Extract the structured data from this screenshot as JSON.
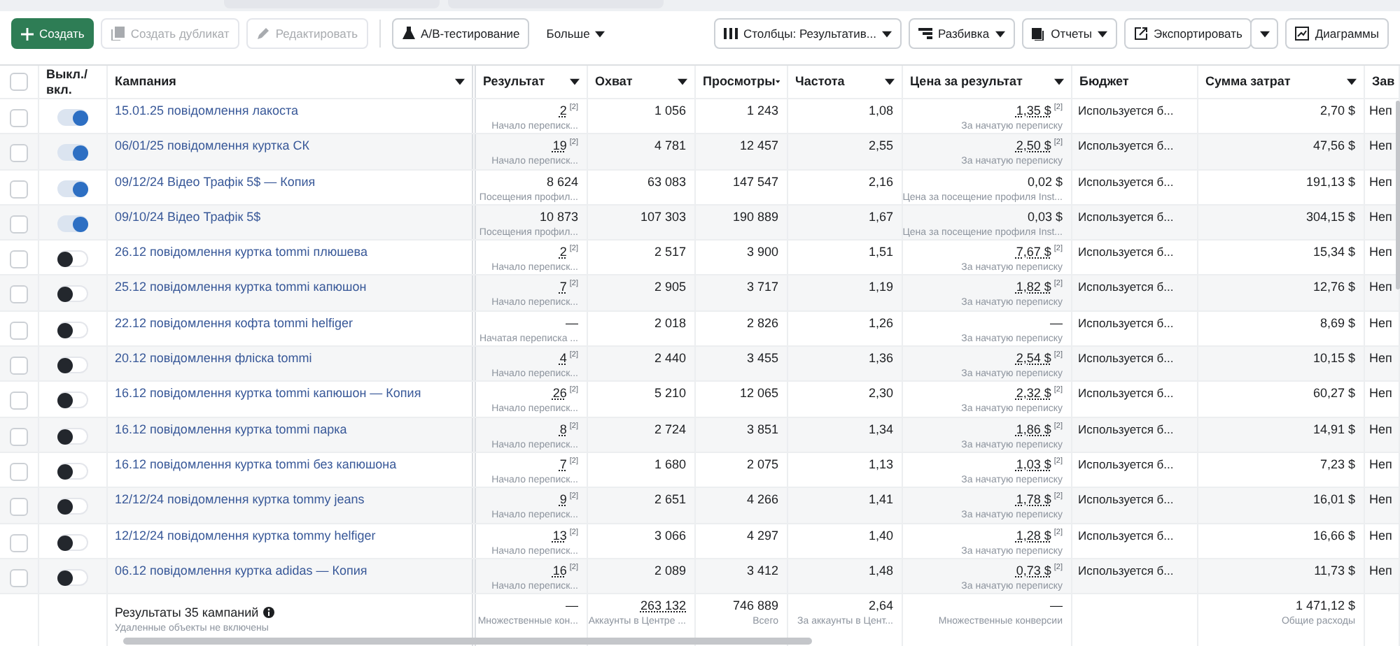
{
  "toolbar": {
    "left": [
      {
        "label": "Создать",
        "kind": "primary",
        "disabled": false
      },
      {
        "label": "Создать дубликат",
        "kind": "default",
        "disabled": true
      },
      {
        "label": "Редактировать",
        "kind": "default",
        "disabled": true
      },
      {
        "label": "A/B-тестирование",
        "kind": "default",
        "disabled": false
      },
      {
        "label": "Больше",
        "kind": "menu",
        "disabled": false
      }
    ],
    "right": [
      {
        "label": "Столбцы: Результатив...",
        "kind": "dropdown",
        "disabled": false
      },
      {
        "label": "Разбивка",
        "kind": "dropdown",
        "disabled": false
      },
      {
        "label": "Отчеты",
        "kind": "dropdown",
        "disabled": false
      },
      {
        "label": "Экспортировать",
        "kind": "split",
        "disabled": false
      },
      {
        "label": "Диаграммы",
        "kind": "default",
        "disabled": false
      }
    ]
  },
  "table": {
    "header_checkbox": {
      "checked": false
    },
    "columns": [
      {
        "label": "Выкл./вкл.",
        "sortable": false
      },
      {
        "label": "Кампания",
        "sortable": true
      },
      {
        "label": "Результат",
        "sortable": true
      },
      {
        "label": "Охват",
        "sortable": true
      },
      {
        "label": "Просмотры",
        "sortable": true
      },
      {
        "label": "Частота",
        "sortable": true
      },
      {
        "label": "Цена за результат",
        "sortable": true
      },
      {
        "label": "Бюджет",
        "sortable": false
      },
      {
        "label": "Сумма затрат",
        "sortable": true
      },
      {
        "label": "Зав"
      }
    ],
    "rows": [
      {
        "checked": false,
        "on": true,
        "campaign": "15.01.25 повідомлення лакоста",
        "result": {
          "value": "2",
          "footnote": "[2]",
          "caption": "Начало переписк..."
        },
        "reach": "1 056",
        "views": "1 243",
        "frequency": "1,08",
        "price": {
          "value": "1,35 $",
          "footnote": "[2]",
          "caption": "За начатую переписку"
        },
        "budget": "Используется б...",
        "spend": "2,70 $",
        "column_10": "Неп"
      },
      {
        "checked": false,
        "on": true,
        "campaign": "06/01/25 повідомлення куртка СК",
        "result": {
          "value": "19",
          "footnote": "[2]",
          "caption": "Начало переписк..."
        },
        "reach": "4 781",
        "views": "12 457",
        "frequency": "2,55",
        "price": {
          "value": "2,50 $",
          "footnote": "[2]",
          "caption": "За начатую переписку"
        },
        "budget": "Используется б...",
        "spend": "47,56 $",
        "column_10": "Неп"
      },
      {
        "checked": false,
        "on": true,
        "campaign": "09/12/24 Відео Трафік 5$ — Копия",
        "result": {
          "value": "8 624",
          "caption": "Посещения профил..."
        },
        "reach": "63 083",
        "views": "147 547",
        "frequency": "2,16",
        "price": {
          "value": "0,02 $",
          "caption": "Цена за посещение профиля Inst..."
        },
        "budget": "Используется б...",
        "spend": "191,13 $",
        "column_10": "Неп"
      },
      {
        "checked": false,
        "on": true,
        "campaign": "09/10/24 Відео Трафік 5$",
        "result": {
          "value": "10 873",
          "caption": "Посещения профил..."
        },
        "reach": "107 303",
        "views": "190 889",
        "frequency": "1,67",
        "price": {
          "value": "0,03 $",
          "caption": "Цена за посещение профиля Inst..."
        },
        "budget": "Используется б...",
        "spend": "304,15 $",
        "column_10": "Неп"
      },
      {
        "checked": false,
        "on": false,
        "campaign": "26.12 повідомлення куртка tommi плюшева",
        "result": {
          "value": "2",
          "footnote": "[2]",
          "caption": "Начало переписк..."
        },
        "reach": "2 517",
        "views": "3 900",
        "frequency": "1,51",
        "price": {
          "value": "7,67 $",
          "footnote": "[2]",
          "caption": "За начатую переписку"
        },
        "budget": "Используется б...",
        "spend": "15,34 $",
        "column_10": "Неп"
      },
      {
        "checked": false,
        "on": false,
        "campaign": "25.12 повідомлення куртка tommi капюшон",
        "result": {
          "value": "7",
          "footnote": "[2]",
          "caption": "Начало переписк..."
        },
        "reach": "2 905",
        "views": "3 717",
        "frequency": "1,19",
        "price": {
          "value": "1,82 $",
          "footnote": "[2]",
          "caption": "За начатую переписку"
        },
        "budget": "Используется б...",
        "spend": "12,76 $",
        "column_10": "Неп"
      },
      {
        "checked": false,
        "on": false,
        "campaign": "22.12 повідомлення кофта tommi helfiger",
        "result": {
          "value": "—",
          "caption": "Начатая переписка ..."
        },
        "reach": "2 018",
        "views": "2 826",
        "frequency": "1,26",
        "price": {
          "value": "—",
          "caption": "За начатую переписку"
        },
        "budget": "Используется б...",
        "spend": "8,69 $",
        "column_10": "Неп"
      },
      {
        "checked": false,
        "on": false,
        "campaign": "20.12 повідомлення фліска tommi",
        "result": {
          "value": "4",
          "footnote": "[2]",
          "caption": "Начало переписк..."
        },
        "reach": "2 440",
        "views": "3 455",
        "frequency": "1,36",
        "price": {
          "value": "2,54 $",
          "footnote": "[2]",
          "caption": "За начатую переписку"
        },
        "budget": "Используется б...",
        "spend": "10,15 $",
        "column_10": "Неп"
      },
      {
        "checked": false,
        "on": false,
        "campaign": "16.12 повідомлення куртка tommi капюшон — Копия",
        "result": {
          "value": "26",
          "footnote": "[2]",
          "caption": "Начало переписк..."
        },
        "reach": "5 210",
        "views": "12 065",
        "frequency": "2,30",
        "price": {
          "value": "2,32 $",
          "footnote": "[2]",
          "caption": "За начатую переписку"
        },
        "budget": "Используется б...",
        "spend": "60,27 $",
        "column_10": "Неп"
      },
      {
        "checked": false,
        "on": false,
        "campaign": "16.12 повідомлення куртка tommi парка",
        "result": {
          "value": "8",
          "footnote": "[2]",
          "caption": "Начало переписк..."
        },
        "reach": "2 724",
        "views": "3 851",
        "frequency": "1,34",
        "price": {
          "value": "1,86 $",
          "footnote": "[2]",
          "caption": "За начатую переписку"
        },
        "budget": "Используется б...",
        "spend": "14,91 $",
        "column_10": "Неп"
      },
      {
        "checked": false,
        "on": false,
        "campaign": "16.12 повідомлення куртка tommi без капюшона",
        "result": {
          "value": "7",
          "footnote": "[2]",
          "caption": "Начало переписк..."
        },
        "reach": "1 680",
        "views": "2 075",
        "frequency": "1,13",
        "price": {
          "value": "1,03 $",
          "footnote": "[2]",
          "caption": "За начатую переписку"
        },
        "budget": "Используется б...",
        "spend": "7,23 $",
        "column_10": "Неп"
      },
      {
        "checked": false,
        "on": false,
        "campaign": "12/12/24 повідомлення куртка tommy jeans",
        "result": {
          "value": "9",
          "footnote": "[2]",
          "caption": "Начало переписк..."
        },
        "reach": "2 651",
        "views": "4 266",
        "frequency": "1,41",
        "price": {
          "value": "1,78 $",
          "footnote": "[2]",
          "caption": "За начатую переписку"
        },
        "budget": "Используется б...",
        "spend": "16,01 $",
        "column_10": "Неп"
      },
      {
        "checked": false,
        "on": false,
        "campaign": "12/12/24 повідомлення куртка tommy helfiger",
        "result": {
          "value": "13",
          "footnote": "[2]",
          "caption": "Начало переписк..."
        },
        "reach": "3 066",
        "views": "4 297",
        "frequency": "1,40",
        "price": {
          "value": "1,28 $",
          "footnote": "[2]",
          "caption": "За начатую переписку"
        },
        "budget": "Используется б...",
        "spend": "16,66 $",
        "column_10": "Неп"
      },
      {
        "checked": false,
        "on": false,
        "campaign": "06.12 повідомлення куртка adidas — Копия",
        "result": {
          "value": "16",
          "footnote": "[2]",
          "caption": "Начало переписк..."
        },
        "reach": "2 089",
        "views": "3 412",
        "frequency": "1,48",
        "price": {
          "value": "0,73 $",
          "footnote": "[2]",
          "caption": "За начатую переписку"
        },
        "budget": "Используется б...",
        "spend": "11,73 $",
        "column_10": "Неп"
      }
    ],
    "summary": {
      "title": "Результаты 35 кампаний",
      "note": "Удаленные объекты не включены",
      "result": {
        "value": "—",
        "caption": "Множественные кон..."
      },
      "reach": {
        "value": "263 132",
        "caption": "Аккаунты в Центре ..."
      },
      "views": {
        "value": "746 889",
        "caption": "Всего"
      },
      "frequency": {
        "value": "2,64",
        "caption": "За аккаунты в Цент..."
      },
      "price": {
        "value": "—",
        "caption": "Множественные конверсии"
      },
      "spend": {
        "value": "1 471,12 $",
        "caption": "Общие расходы"
      }
    }
  }
}
